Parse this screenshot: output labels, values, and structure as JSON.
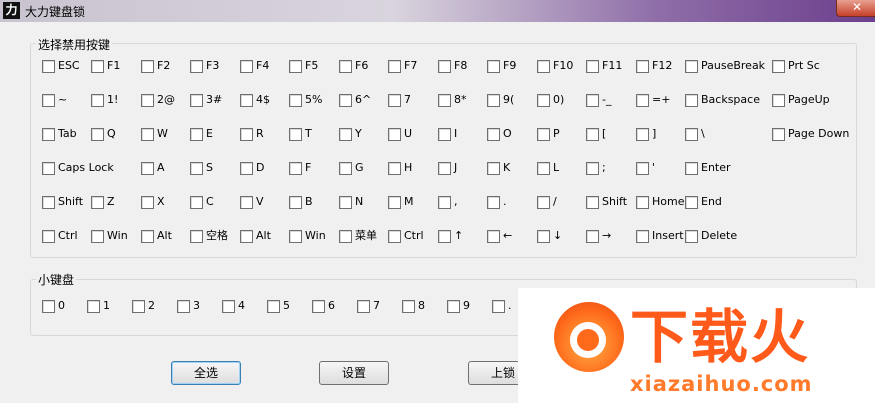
{
  "window": {
    "title": "大力键盘锁",
    "app_icon_glyph": "力",
    "close_glyph": "✕"
  },
  "main_group": {
    "title": "选择禁用按键",
    "rows": [
      [
        "ESC",
        "F1",
        "F2",
        "F3",
        "F4",
        "F5",
        "F6",
        "F7",
        "F8",
        "F9",
        "F10",
        "F11",
        "F12",
        "PauseBreak",
        "Prt Sc"
      ],
      [
        "~",
        "1!",
        "2@",
        "3#",
        "4$",
        "5%",
        "6^",
        "7",
        "8*",
        "9(",
        "0)",
        "-_",
        "=+",
        "Backspace",
        "PageUp"
      ],
      [
        "Tab",
        "Q",
        "W",
        "E",
        "R",
        "T",
        "Y",
        "U",
        "I",
        "O",
        "P",
        "[",
        "]",
        "\\",
        "Page Down"
      ],
      [
        "Caps Lock",
        "A",
        "S",
        "D",
        "F",
        "G",
        "H",
        "J",
        "K",
        "L",
        ";",
        "'",
        "Enter"
      ],
      [
        "Shift",
        "Z",
        "X",
        "C",
        "V",
        "B",
        "N",
        "M",
        ",",
        ".",
        "/",
        "Shift",
        "Home",
        "End"
      ],
      [
        "Ctrl",
        "Win",
        "Alt",
        "空格",
        "Alt",
        "Win",
        "菜单",
        "Ctrl",
        "↑",
        "←",
        "↓",
        "→",
        "Insert",
        "Delete"
      ]
    ]
  },
  "numpad_group": {
    "title": "小键盘",
    "keys": [
      "0",
      "1",
      "2",
      "3",
      "4",
      "5",
      "6",
      "7",
      "8",
      "9",
      "."
    ]
  },
  "buttons": {
    "select_all": "全选",
    "settings": "设置",
    "lock": "上锁"
  },
  "watermark": {
    "chinese": "下载火",
    "domain": "xiazaihuo.com"
  }
}
